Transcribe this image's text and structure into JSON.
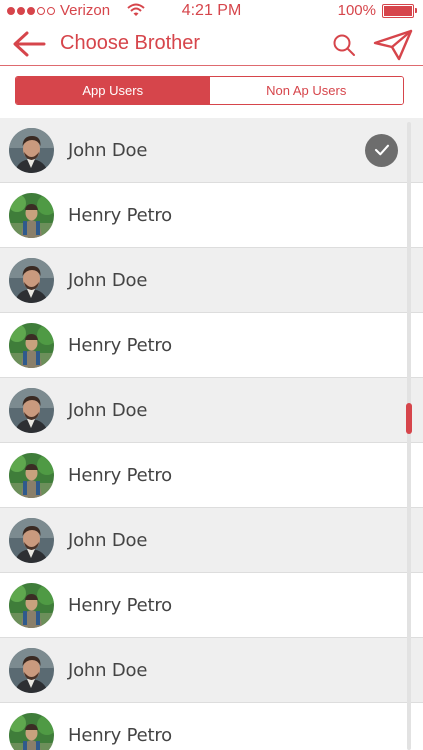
{
  "status_bar": {
    "carrier": "Verizon",
    "time": "4:21 PM",
    "battery": "100%",
    "signal_bars_filled": 3,
    "signal_bars_total": 5
  },
  "nav": {
    "title": "Choose Brother",
    "back_icon": "arrow-left-icon",
    "search_icon": "search-icon",
    "send_icon": "paper-plane-icon"
  },
  "tabs": [
    {
      "label": "App Users",
      "active": true
    },
    {
      "label": "Non Ap Users",
      "active": false
    }
  ],
  "contacts": [
    {
      "name": "John Doe",
      "avatar": "man-portrait",
      "selected": true
    },
    {
      "name": "Henry Petro",
      "avatar": "hiker-portrait",
      "selected": false
    },
    {
      "name": "John Doe",
      "avatar": "man-portrait",
      "selected": false
    },
    {
      "name": "Henry Petro",
      "avatar": "hiker-portrait",
      "selected": false
    },
    {
      "name": "John Doe",
      "avatar": "man-portrait",
      "selected": false
    },
    {
      "name": "Henry Petro",
      "avatar": "hiker-portrait",
      "selected": false
    },
    {
      "name": "John Doe",
      "avatar": "man-portrait",
      "selected": false
    },
    {
      "name": "Henry Petro",
      "avatar": "hiker-portrait",
      "selected": false
    },
    {
      "name": "John Doe",
      "avatar": "man-portrait",
      "selected": false
    },
    {
      "name": "Henry Petro",
      "avatar": "hiker-portrait",
      "selected": false
    }
  ],
  "colors": {
    "accent": "#d6454b",
    "row_shaded": "#efefef",
    "check_badge": "#6d6d6d"
  }
}
